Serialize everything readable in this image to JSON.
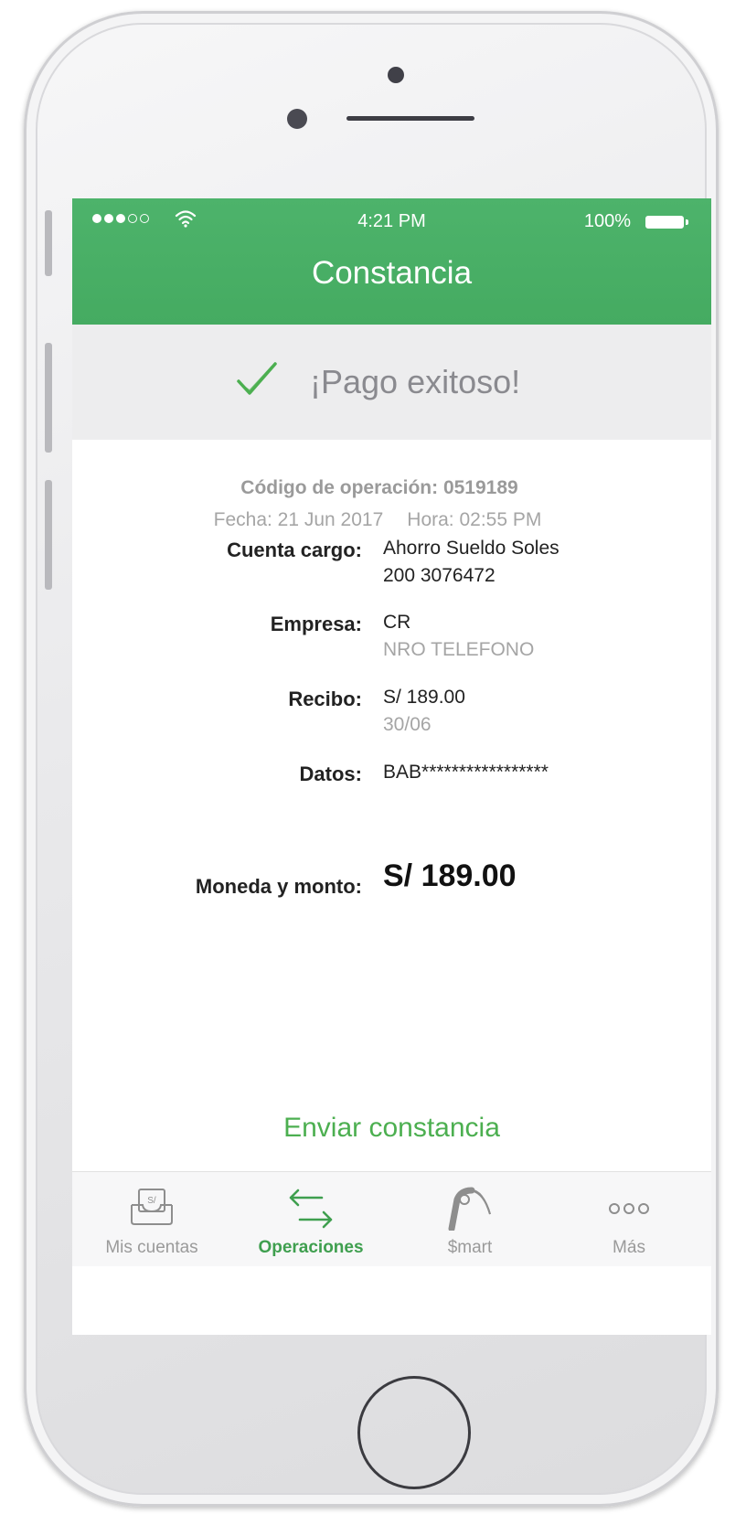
{
  "status_bar": {
    "time": "4:21 PM",
    "battery": "100%"
  },
  "nav": {
    "title": "Constancia"
  },
  "banner": {
    "message": "¡Pago exitoso!"
  },
  "operation": {
    "code": "Código de operación: 0519189",
    "date": "Fecha: 21 Jun 2017",
    "time": "Hora: 02:55 PM"
  },
  "details": [
    {
      "label": "Cuenta cargo:",
      "value": "Ahorro Sueldo Soles",
      "sub": "200 3076472"
    },
    {
      "label": "Empresa:",
      "value": "CR",
      "sub": "NRO TELEFONO"
    },
    {
      "label": "Recibo:",
      "value": "S/ 189.00",
      "sub": "30/06"
    },
    {
      "label": "Datos:",
      "value": "BAB*****************"
    }
  ],
  "amount": {
    "label": "Moneda y monto:",
    "value": "S/ 189.00"
  },
  "actions": {
    "send": "Enviar constancia"
  },
  "tabs": [
    {
      "label": "Mis cuentas",
      "icon": "wallet-icon",
      "active": false
    },
    {
      "label": "Operaciones",
      "icon": "transfer-arrows-icon",
      "active": true
    },
    {
      "label": "$mart",
      "icon": "smart-key-icon",
      "active": false
    },
    {
      "label": "Más",
      "icon": "more-dots-icon",
      "active": false
    }
  ],
  "colors": {
    "accent": "#4db36b",
    "active_tab": "#3f9f4f",
    "banner_bg": "#ededee"
  }
}
